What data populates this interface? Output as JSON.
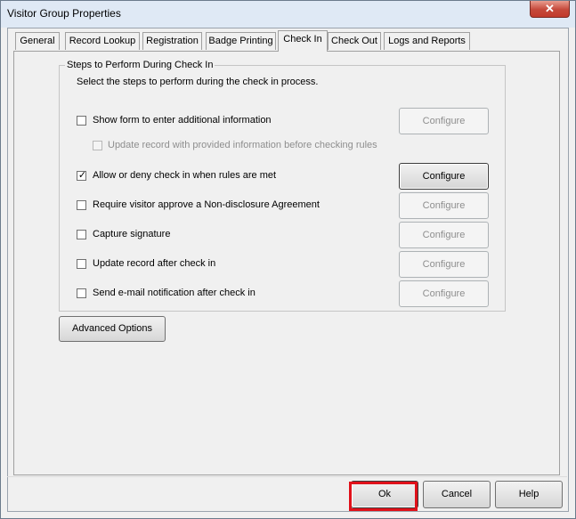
{
  "window": {
    "title": "Visitor Group Properties",
    "close_label": "✕"
  },
  "tabs": [
    {
      "label": "General"
    },
    {
      "label": "Record Lookup"
    },
    {
      "label": "Registration"
    },
    {
      "label": "Badge Printing"
    },
    {
      "label": "Check In",
      "selected": true
    },
    {
      "label": "Check Out"
    },
    {
      "label": "Logs and Reports"
    }
  ],
  "group": {
    "title": "Steps to Perform During Check In",
    "description": "Select the steps to perform during the check in process.",
    "steps": [
      {
        "label": "Show form to enter additional information",
        "checked": false,
        "enabled": true,
        "configure": "Configure",
        "configure_enabled": false
      },
      {
        "label": "Update record with provided information before checking rules",
        "checked": false,
        "enabled": false
      },
      {
        "label": "Allow or deny check in when rules are met",
        "checked": true,
        "enabled": true,
        "configure": "Configure",
        "configure_enabled": true
      },
      {
        "label": "Require visitor approve a Non-disclosure Agreement",
        "checked": false,
        "enabled": true,
        "configure": "Configure",
        "configure_enabled": false
      },
      {
        "label": "Capture signature",
        "checked": false,
        "enabled": true,
        "configure": "Configure",
        "configure_enabled": false
      },
      {
        "label": "Update record after check in",
        "checked": false,
        "enabled": true,
        "configure": "Configure",
        "configure_enabled": false
      },
      {
        "label": "Send e-mail notification after check in",
        "checked": false,
        "enabled": true,
        "configure": "Configure",
        "configure_enabled": false
      }
    ],
    "checkmark": "✓"
  },
  "advanced_options_label": "Advanced Options",
  "footer": {
    "ok_label": "Ok",
    "cancel_label": "Cancel",
    "help_label": "Help"
  },
  "colors": {
    "highlight": "#e0111a",
    "title_bar": "#dfe9f5",
    "close": "#c5483a"
  }
}
